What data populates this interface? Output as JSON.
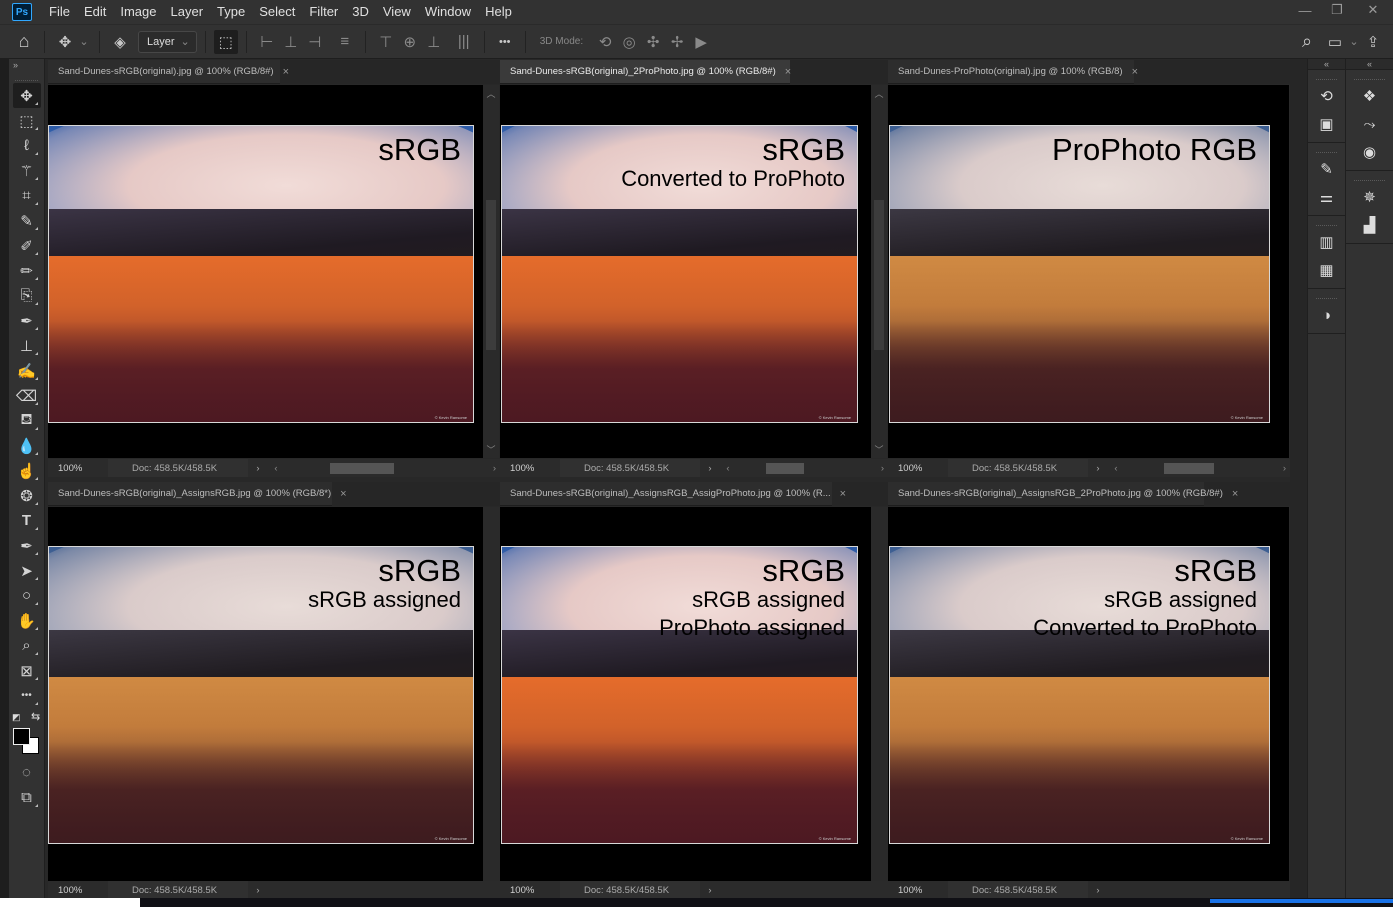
{
  "app": {
    "logo": "Ps",
    "menu": [
      "File",
      "Edit",
      "Image",
      "Layer",
      "Type",
      "Select",
      "Filter",
      "3D",
      "View",
      "Window",
      "Help"
    ],
    "window_controls": {
      "minimize": "—",
      "restore": "❐",
      "close": "✕"
    }
  },
  "options_bar": {
    "home_icon": "⌂",
    "move_icon": "✥",
    "dropdown_arrow": "⌄",
    "auto_select_icon": "◈",
    "auto_select_target": "Layer",
    "transform_controls_icon": "⬚",
    "align_icons": [
      "⊢",
      "⊥",
      "⊣",
      "≡",
      "⊤",
      "⊕",
      "⊥",
      "|||"
    ],
    "more_label": "•••",
    "mode_label": "3D Mode:",
    "mode_icons": [
      "⟲",
      "◎",
      "✣",
      "✢",
      "▶"
    ],
    "search_icon": "⌕",
    "workspace_icon": "▭",
    "share_icon": "⇪"
  },
  "toolbar": {
    "collapse_label": "»",
    "tools": [
      {
        "name": "move-tool",
        "glyph": "✥",
        "active": true
      },
      {
        "name": "marquee-tool",
        "glyph": "⬚"
      },
      {
        "name": "lasso-tool",
        "glyph": "ℓ"
      },
      {
        "name": "magic-wand-tool",
        "glyph": "⚚"
      },
      {
        "name": "crop-tool",
        "glyph": "⌗"
      },
      {
        "name": "eyedropper-tool",
        "glyph": "✎"
      },
      {
        "name": "healing-brush-tool",
        "glyph": "✐"
      },
      {
        "name": "brush-tool",
        "glyph": "✏"
      },
      {
        "name": "clone-tool",
        "glyph": "⎘"
      },
      {
        "name": "history-brush-tool",
        "glyph": "✒"
      },
      {
        "name": "stamp-tool",
        "glyph": "⊥"
      },
      {
        "name": "mixer-brush-tool",
        "glyph": "✍"
      },
      {
        "name": "eraser-tool",
        "glyph": "⌫"
      },
      {
        "name": "paint-bucket-tool",
        "glyph": "⛾"
      },
      {
        "name": "blur-tool",
        "glyph": "💧"
      },
      {
        "name": "smudge-tool",
        "glyph": "☝"
      },
      {
        "name": "sponge-tool",
        "glyph": "❂"
      },
      {
        "name": "type-tool",
        "glyph": "T"
      },
      {
        "name": "pen-tool",
        "glyph": "✒"
      },
      {
        "name": "path-selection-tool",
        "glyph": "➤"
      },
      {
        "name": "ellipse-tool",
        "glyph": "○"
      },
      {
        "name": "hand-tool",
        "glyph": "✋"
      },
      {
        "name": "zoom-tool",
        "glyph": "⌕"
      },
      {
        "name": "frame-tool",
        "glyph": "⊠"
      },
      {
        "name": "edit-toolbar",
        "glyph": "•••"
      }
    ],
    "default_colors_icon": "◩",
    "swap_colors_icon": "⇆",
    "foreground_color": "#000000",
    "background_color": "#ffffff",
    "quick_mask_icon": "◌",
    "screen_mode_icon": "⧉"
  },
  "documents": [
    {
      "tab_title": "Sand-Dunes-sRGB(original).jpg @ 100% (RGB/8#)",
      "active": false,
      "overlay": [
        "sRGB"
      ],
      "tone": "srgb",
      "zoom": "100%",
      "doc_size": "Doc: 458.5K/458.5K"
    },
    {
      "tab_title": "Sand-Dunes-sRGB(original)_2ProPhoto.jpg @ 100% (RGB/8#)",
      "active": true,
      "overlay": [
        "sRGB",
        "Converted to ProPhoto"
      ],
      "tone": "srgb",
      "zoom": "100%",
      "doc_size": "Doc: 458.5K/458.5K"
    },
    {
      "tab_title": "Sand-Dunes-ProPhoto(original).jpg @ 100% (RGB/8)",
      "active": false,
      "overlay": [
        "ProPhoto RGB"
      ],
      "tone": "muted",
      "zoom": "100%",
      "doc_size": "Doc: 458.5K/458.5K"
    },
    {
      "tab_title": "Sand-Dunes-sRGB(original)_AssignsRGB.jpg @ 100% (RGB/8*)",
      "active": false,
      "overlay": [
        "sRGB",
        "sRGB assigned"
      ],
      "tone": "muted",
      "zoom": "100%",
      "doc_size": "Doc: 458.5K/458.5K"
    },
    {
      "tab_title": "Sand-Dunes-sRGB(original)_AssignsRGB_AssigProPhoto.jpg @ 100% (R...",
      "active": false,
      "overlay": [
        "sRGB",
        "sRGB assigned",
        "ProPhoto assigned"
      ],
      "tone": "srgb",
      "zoom": "100%",
      "doc_size": "Doc: 458.5K/458.5K"
    },
    {
      "tab_title": "Sand-Dunes-sRGB(original)_AssignsRGB_2ProPhoto.jpg @ 100% (RGB/8#)",
      "active": false,
      "overlay": [
        "sRGB",
        "sRGB assigned",
        "Converted to ProPhoto"
      ],
      "tone": "muted",
      "zoom": "100%",
      "doc_size": "Doc: 458.5K/458.5K"
    }
  ],
  "photo_copyright": "© Kevin Ransome",
  "close_glyph": "×",
  "status_more": "›",
  "scroll_left": "‹",
  "scroll_right": "›",
  "scroll_up": "︿",
  "scroll_down": "﹀",
  "dock": {
    "collapse1": "«",
    "collapse2": "«",
    "column1": [
      [
        "history-icon",
        "properties-icon"
      ],
      [
        "brush-settings-icon",
        "adjust-brush-icon"
      ],
      [
        "gradients-icon",
        "patterns-icon"
      ],
      [
        "adjustments-icon"
      ]
    ],
    "column1_glyphs": [
      [
        "⟲",
        "▣"
      ],
      [
        "✎",
        "⚌"
      ],
      [
        "▥",
        "▦"
      ],
      [
        "◑"
      ]
    ],
    "column2": [
      [
        "layers-icon",
        "paths-icon",
        "channels-icon"
      ],
      [
        "navigator-icon",
        "histogram-icon"
      ]
    ],
    "column2_glyphs": [
      [
        "❖",
        "⤳",
        "◉"
      ],
      [
        "✵",
        "▟"
      ]
    ]
  }
}
